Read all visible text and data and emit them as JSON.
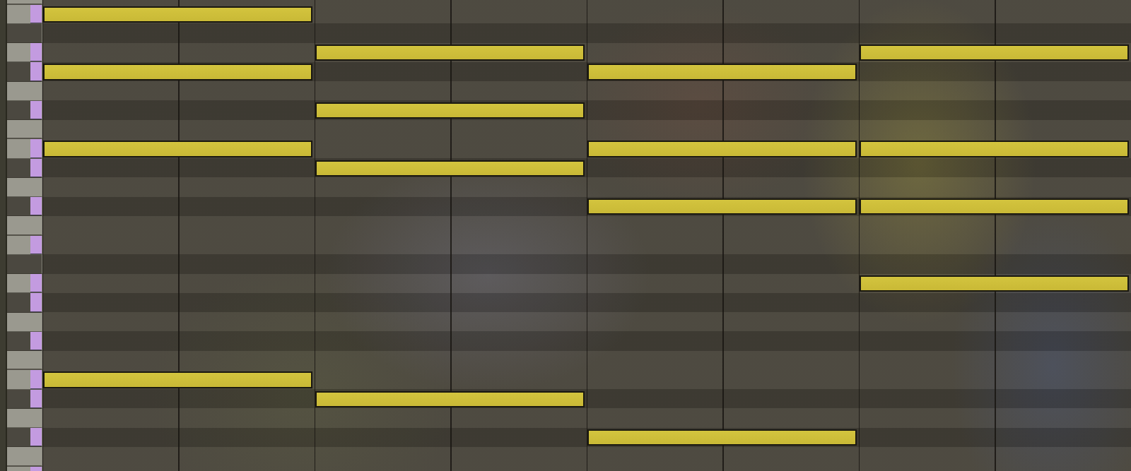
{
  "piano_roll": {
    "rows": [
      {
        "kind": "white",
        "highlighted": false,
        "notes": [
          false,
          false,
          false,
          false
        ]
      },
      {
        "kind": "white",
        "highlighted": true,
        "notes": [
          true,
          false,
          false,
          false
        ]
      },
      {
        "kind": "black",
        "highlighted": false,
        "notes": [
          false,
          false,
          false,
          false
        ]
      },
      {
        "kind": "white",
        "highlighted": true,
        "notes": [
          false,
          true,
          false,
          true
        ]
      },
      {
        "kind": "black",
        "highlighted": true,
        "notes": [
          true,
          false,
          true,
          false
        ]
      },
      {
        "kind": "white",
        "highlighted": false,
        "notes": [
          false,
          false,
          false,
          false
        ]
      },
      {
        "kind": "black",
        "highlighted": true,
        "notes": [
          false,
          true,
          false,
          false
        ]
      },
      {
        "kind": "white",
        "highlighted": false,
        "notes": [
          false,
          false,
          false,
          false
        ]
      },
      {
        "kind": "white",
        "highlighted": true,
        "notes": [
          true,
          false,
          true,
          true
        ]
      },
      {
        "kind": "black",
        "highlighted": true,
        "notes": [
          false,
          true,
          false,
          false
        ]
      },
      {
        "kind": "white",
        "highlighted": false,
        "notes": [
          false,
          false,
          false,
          false
        ]
      },
      {
        "kind": "black",
        "highlighted": true,
        "notes": [
          false,
          false,
          true,
          true
        ]
      },
      {
        "kind": "white",
        "highlighted": false,
        "notes": [
          false,
          false,
          false,
          false
        ]
      },
      {
        "kind": "white",
        "highlighted": true,
        "notes": [
          false,
          false,
          false,
          false
        ]
      },
      {
        "kind": "black",
        "highlighted": false,
        "notes": [
          false,
          false,
          false,
          false
        ]
      },
      {
        "kind": "white",
        "highlighted": true,
        "notes": [
          false,
          false,
          false,
          true
        ]
      },
      {
        "kind": "black",
        "highlighted": true,
        "notes": [
          false,
          false,
          false,
          false
        ]
      },
      {
        "kind": "white",
        "highlighted": false,
        "notes": [
          false,
          false,
          false,
          false
        ]
      },
      {
        "kind": "black",
        "highlighted": true,
        "notes": [
          false,
          false,
          false,
          false
        ]
      },
      {
        "kind": "white",
        "highlighted": false,
        "notes": [
          false,
          false,
          false,
          false
        ]
      },
      {
        "kind": "white",
        "highlighted": true,
        "notes": [
          true,
          false,
          false,
          false
        ]
      },
      {
        "kind": "black",
        "highlighted": true,
        "notes": [
          false,
          true,
          false,
          false
        ]
      },
      {
        "kind": "white",
        "highlighted": false,
        "notes": [
          false,
          false,
          false,
          false
        ]
      },
      {
        "kind": "black",
        "highlighted": true,
        "notes": [
          false,
          false,
          true,
          false
        ]
      },
      {
        "kind": "white",
        "highlighted": false,
        "notes": [
          false,
          false,
          false,
          false
        ]
      },
      {
        "kind": "white",
        "highlighted": true,
        "notes": [
          false,
          false,
          false,
          false
        ]
      }
    ]
  }
}
